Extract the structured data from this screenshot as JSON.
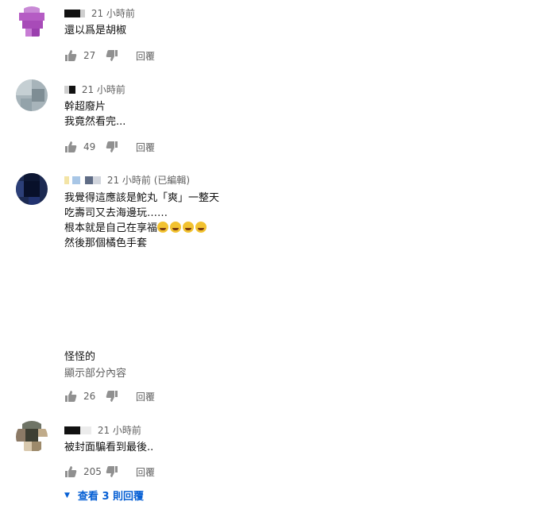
{
  "comments": [
    {
      "time": "21 小時前",
      "lines": [
        "還以爲是胡椒"
      ],
      "likes": "27",
      "reply": "回覆"
    },
    {
      "time": "21 小時前",
      "lines": [
        "幹超廢片",
        "我竟然看完..."
      ],
      "likes": "49",
      "reply": "回覆"
    },
    {
      "time": "21 小時前 (已編輯)",
      "lines": [
        "我覺得這應該是鮀丸「爽」一整天",
        "吃壽司又去海邊玩……",
        "根本就是自己在享福",
        "然後那個橘色手套",
        "怪怪的"
      ],
      "show_more": "顯示部分內容",
      "likes": "26",
      "reply": "回覆"
    },
    {
      "time": "21 小時前",
      "lines": [
        "被封面騙看到最後.."
      ],
      "likes": "205",
      "reply": "回覆",
      "view_replies": "查看 3 則回覆"
    }
  ],
  "icons": {
    "like": "thumbs-up-icon",
    "dislike": "thumbs-down-icon",
    "emoji": "grinning-squinting-face-emoji",
    "expand": "caret-down-icon"
  },
  "colors": {
    "link": "#065fd4",
    "secondary_text": "#606060"
  }
}
